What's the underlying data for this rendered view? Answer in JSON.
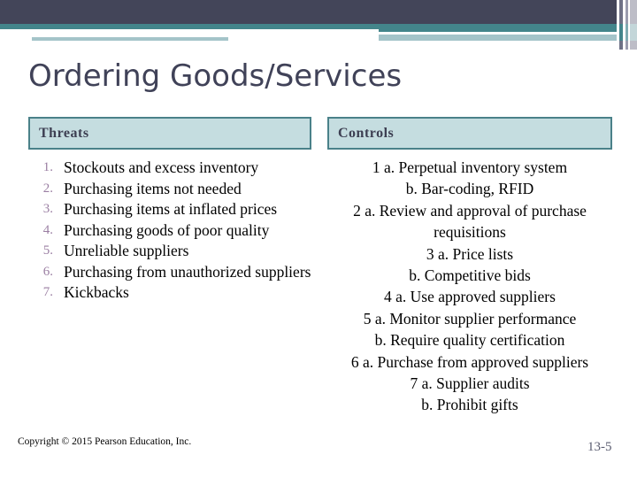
{
  "slide": {
    "title": "Ordering Goods/Services",
    "page_number": "13-5",
    "copyright": "Copyright © 2015 Pearson Education, Inc."
  },
  "theme": {
    "dark_band": "#434559",
    "teal_band": "#43858b",
    "light_teal_band": "#a4c4c9",
    "header_fill": "#c5dde0",
    "header_border": "#4a8189",
    "title_color": "#404258",
    "number_color": "#9b7fa3",
    "page_number_color": "#5a5c70"
  },
  "table": {
    "columns": [
      {
        "header": "Threats"
      },
      {
        "header": "Controls"
      }
    ],
    "threats": [
      {
        "num": "1.",
        "text": "Stockouts and excess inventory"
      },
      {
        "num": "2.",
        "text": "Purchasing items not needed"
      },
      {
        "num": "3.",
        "text": "Purchasing items at inflated prices"
      },
      {
        "num": "4.",
        "text": "Purchasing goods of poor quality"
      },
      {
        "num": "5.",
        "text": "Unreliable suppliers"
      },
      {
        "num": "6.",
        "text": "Purchasing from unauthorized suppliers"
      },
      {
        "num": "7.",
        "text": "Kickbacks"
      }
    ],
    "controls": [
      {
        "text": "1 a. Perpetual inventory system"
      },
      {
        "text": "b. Bar-coding, RFID"
      },
      {
        "text": "2 a. Review and approval of purchase requisitions"
      },
      {
        "text": "3 a. Price lists"
      },
      {
        "text": "b. Competitive bids"
      },
      {
        "text": "4 a. Use approved suppliers"
      },
      {
        "text": "5 a. Monitor supplier performance"
      },
      {
        "text": "b. Require quality certification"
      },
      {
        "text": "6 a. Purchase from approved suppliers"
      },
      {
        "text": "7 a. Supplier audits"
      },
      {
        "text": "b. Prohibit gifts"
      }
    ]
  }
}
